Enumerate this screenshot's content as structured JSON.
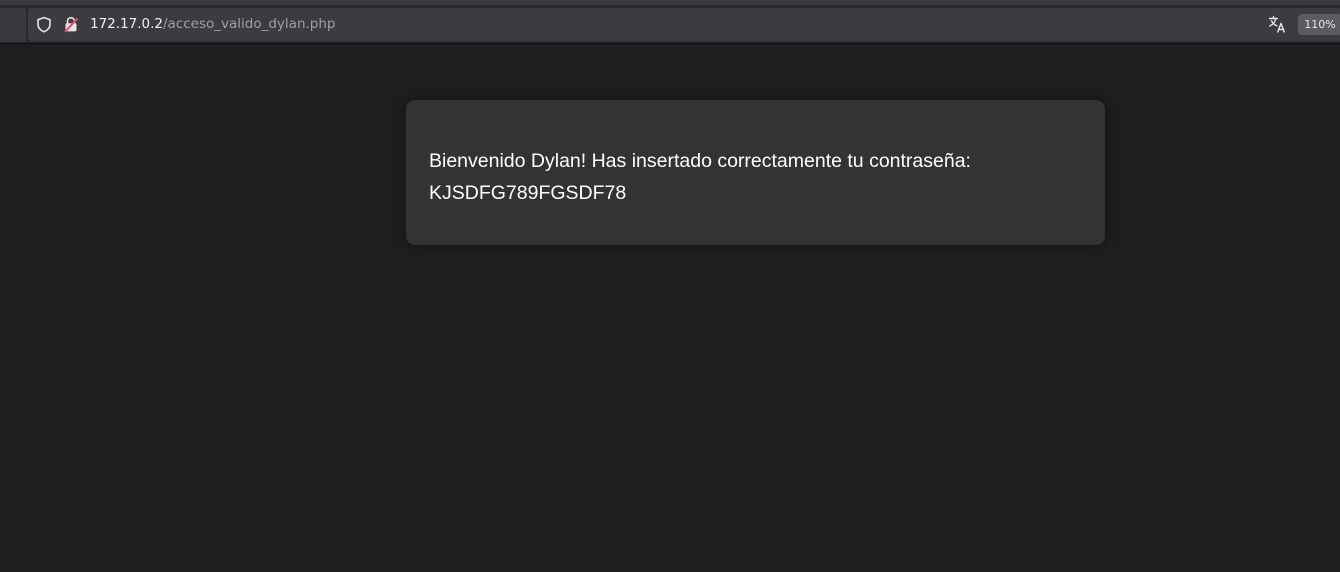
{
  "browser": {
    "url_host": "172.17.0.2",
    "url_path": "/acceso_valido_dylan.php",
    "zoom_level": "110%",
    "icons": {
      "security": "shield-icon",
      "connection": "insecure-lock-icon",
      "translate": "translate-icon"
    }
  },
  "page": {
    "welcome_text": "Bienvenido Dylan! Has insertado correctamente tu contraseña:",
    "password_text": "KJSDFG789FGSDF78"
  },
  "colors": {
    "page_background": "#1e1e1e",
    "card_background": "#333333",
    "text": "#ffffff",
    "insecure_lock": "#e5487a"
  }
}
